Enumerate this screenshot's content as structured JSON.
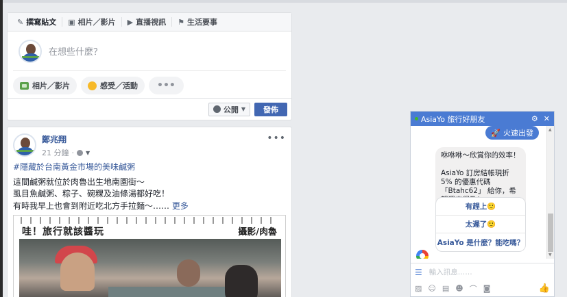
{
  "composer": {
    "tabs": [
      {
        "label": "撰寫貼文",
        "icon": "pencil-icon"
      },
      {
        "label": "相片／影片",
        "icon": "camera-icon"
      },
      {
        "label": "直播視訊",
        "icon": "video-camera-icon"
      },
      {
        "label": "生活要事",
        "icon": "flag-icon"
      }
    ],
    "placeholder": "在想些什麼？",
    "actions": [
      "相片／影片",
      "感受／活動",
      "•••"
    ],
    "audience": "公開",
    "post_button": "發佈"
  },
  "post": {
    "author": "鄭兆翔",
    "time": "21 分鐘",
    "hashtag": "#隱藏於台南黃金市場的美味鹹粥",
    "lines": [
      "這間鹹粥就位於肉魯出生地南園街～",
      "虱目魚鹹粥、粽子、碗粿及油條湯都好吃！",
      "有時我早上也會到附近吃北方手拉麵～……"
    ],
    "see_more": "更多",
    "more_icon": "•••",
    "image_title": "哇！旅行就該醬玩",
    "image_credit": "攝影/肉魯"
  },
  "messenger": {
    "title": "AsiaYo 旅行好朋友",
    "accent_color": "#4a7bd3",
    "outgoing": "火速出發",
    "incoming_p1": "咻咻咻～欣賞你的效率！",
    "incoming_p2": "AsiaYo 訂房結帳現折 5% 的優惠代碼 「Btahc62」 給你，希望還來得及！",
    "quick_replies": [
      "有趕上🙂",
      "太遲了🙂",
      "AsiaYo 是什麼？能吃嗎？"
    ],
    "input_placeholder": "輸入訊息……"
  }
}
